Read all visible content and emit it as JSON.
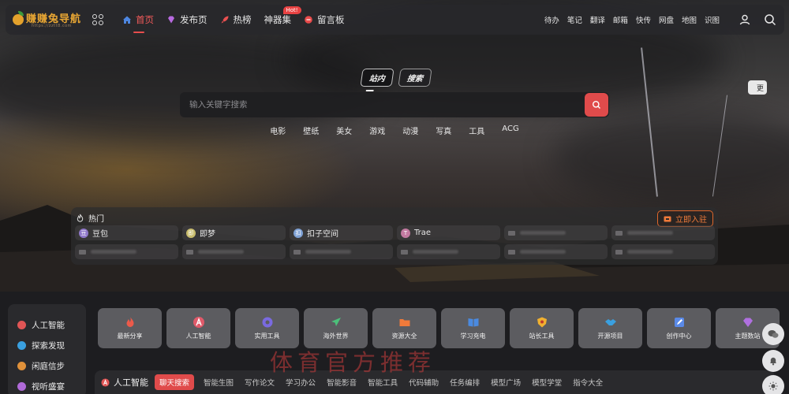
{
  "brand": {
    "name": "赚赚兔导航",
    "url": "https://zztt8.com"
  },
  "nav": {
    "items": [
      {
        "label": "首页",
        "active": true,
        "icon": "home-icon"
      },
      {
        "label": "发布页",
        "icon": "diamond-icon"
      },
      {
        "label": "热榜",
        "icon": "rocket-icon"
      },
      {
        "label": "神器集",
        "icon": "none",
        "badge": "Hot!"
      },
      {
        "label": "留言板",
        "icon": "chat-bubble-icon"
      }
    ],
    "links": [
      "待办",
      "笔记",
      "翻译",
      "邮箱",
      "快传",
      "网盘",
      "地图",
      "识图"
    ]
  },
  "search": {
    "tabs": [
      "站内",
      "搜索"
    ],
    "placeholder": "输入关键字搜索",
    "quick_links": [
      "电影",
      "壁纸",
      "美女",
      "游戏",
      "动漫",
      "写真",
      "工具",
      "ACG"
    ]
  },
  "hot": {
    "title": "热门",
    "join_label": "立即入驻",
    "items": [
      {
        "label": "豆包",
        "initial": "豆",
        "color": "#8f78c9"
      },
      {
        "label": "即梦",
        "initial": "即",
        "color": "#c9bd6e"
      },
      {
        "label": "扣子空间",
        "initial": "扣",
        "color": "#7fa2d6"
      },
      {
        "label": "Trae",
        "initial": "T",
        "color": "#c47aa1"
      }
    ]
  },
  "sidebar": {
    "items": [
      {
        "label": "人工智能",
        "color": "#e05555"
      },
      {
        "label": "探索发现",
        "color": "#3aa0e0"
      },
      {
        "label": "闲庭信步",
        "color": "#e0913a"
      },
      {
        "label": "视听盛宴",
        "color": "#b06ad8"
      }
    ]
  },
  "categories": [
    {
      "label": "最新分享",
      "color": "#ec5a4a"
    },
    {
      "label": "人工智能",
      "color": "#e05a6a"
    },
    {
      "label": "实用工具",
      "color": "#7a6ae0"
    },
    {
      "label": "海外世界",
      "color": "#4cc07a"
    },
    {
      "label": "资源大全",
      "color": "#f07a3a"
    },
    {
      "label": "学习充电",
      "color": "#4a8ae0"
    },
    {
      "label": "站长工具",
      "color": "#f0b030"
    },
    {
      "label": "开源项目",
      "color": "#3aa0e0"
    },
    {
      "label": "创作中心",
      "color": "#5a8ae8"
    },
    {
      "label": "主题数站",
      "color": "#b070e0"
    }
  ],
  "section": {
    "title": "人工智能",
    "tabs": [
      "聊天搜索",
      "智能生图",
      "写作论文",
      "学习办公",
      "智能影音",
      "智能工具",
      "代码辅助",
      "任务编排",
      "模型广场",
      "模型学堂",
      "指令大全"
    ],
    "active_tab": 0,
    "more_label": "更"
  },
  "watermark": "体育官方推荐"
}
